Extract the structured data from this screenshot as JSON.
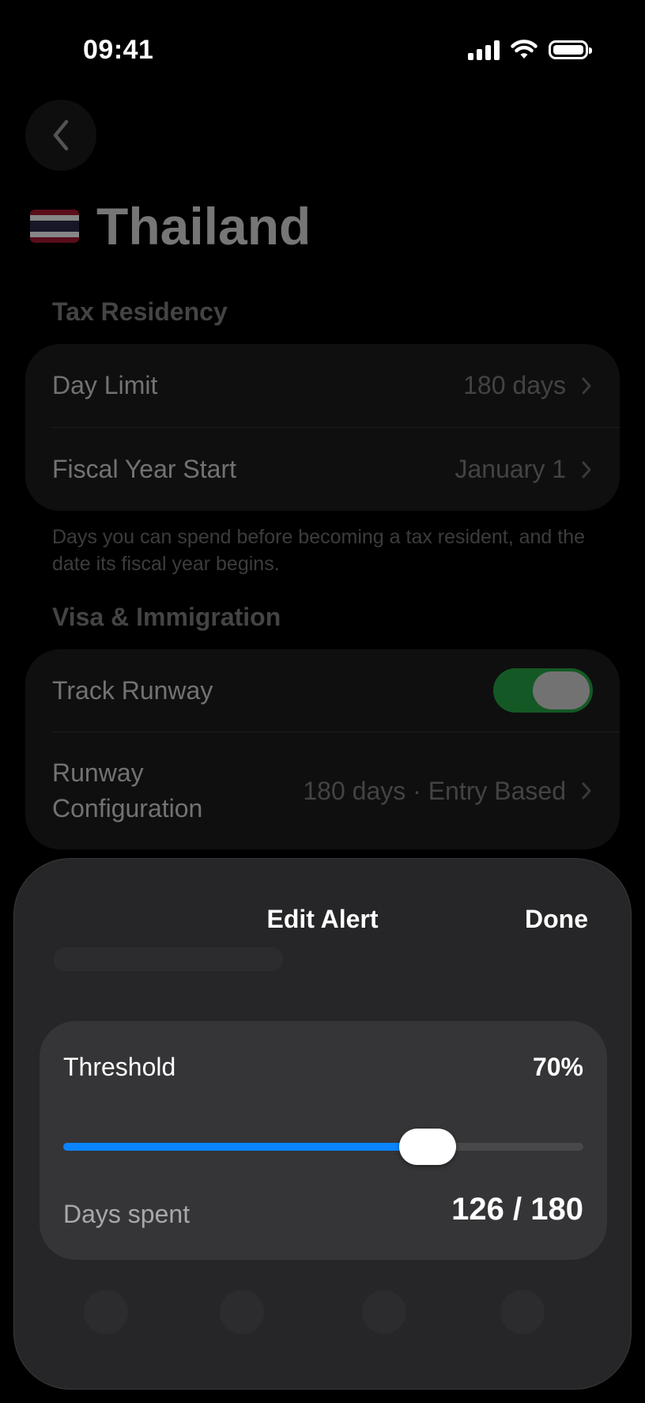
{
  "status_bar": {
    "time": "09:41",
    "icons": [
      "cellular-signal-icon",
      "wifi-icon",
      "battery-icon"
    ]
  },
  "page": {
    "back_icon": "chevron-left-icon",
    "flag": "thailand-flag",
    "title": "Thailand",
    "tax_residency": {
      "header": "Tax Residency",
      "rows": [
        {
          "label": "Day Limit",
          "value": "180 days"
        },
        {
          "label": "Fiscal Year Start",
          "value": "January 1"
        }
      ],
      "footnote": "Days you can spend before becoming a tax resident, and the date its fiscal year begins."
    },
    "visa": {
      "header": "Visa & Immigration",
      "track_runway_label": "Track Runway",
      "track_runway_on": true,
      "runway_config_label_1": "Runway",
      "runway_config_label_2": "Configuration",
      "runway_config_value": "180 days · Entry Based"
    }
  },
  "sheet": {
    "title": "Edit Alert",
    "done_label": "Done",
    "threshold_label": "Threshold",
    "threshold_value": "70%",
    "threshold_fraction": 0.7,
    "days_spent_label": "Days spent",
    "days_spent_value": "126 / 180"
  },
  "colors": {
    "accent": "#0a84ff",
    "toggle_on": "#25a244",
    "thai_flag": [
      "#a51931",
      "#f4f5f8",
      "#2d2a4a",
      "#f4f5f8",
      "#a51931"
    ]
  }
}
